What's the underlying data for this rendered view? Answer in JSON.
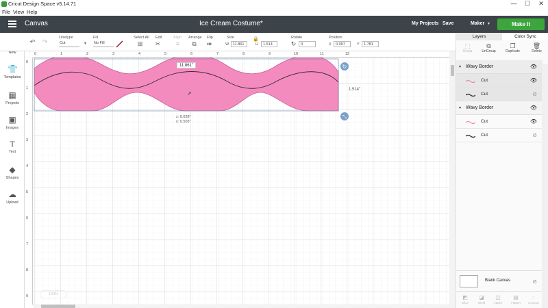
{
  "window": {
    "title": "Cricut Design Space  v5.14.71",
    "minimize": "—",
    "maximize": "☐",
    "close": "✕"
  },
  "menu": {
    "items": [
      "File",
      "View",
      "Help"
    ]
  },
  "header": {
    "section": "Canvas",
    "project_name": "Ice Cream Costume*",
    "my_projects": "My Projects",
    "save": "Save",
    "machine": "Maker",
    "make_it": "Make It",
    "colors": {
      "bar": "#3d4449",
      "make_it": "#3ca53c"
    }
  },
  "toolbar": {
    "linetype_label": "Linetype",
    "linetype_value": "Cut",
    "fill_label": "Fill",
    "fill_value": "No Fill",
    "select_all_label": "Select All",
    "edit_label": "Edit",
    "align_label": "Align",
    "arrange_label": "Arrange",
    "flip_label": "Flip",
    "size_label": "Size",
    "w_label": "W",
    "w_value": "11.861",
    "h_label": "H",
    "h_value": "1.514",
    "rotate_label": "Rotate",
    "rotate_value": "0",
    "position_label": "Position",
    "x_label": "X",
    "x_value": "0.097",
    "y_label": "Y",
    "y_value": "1.781"
  },
  "sidebar": {
    "items": [
      {
        "label": "New",
        "icon": "plus-circle-icon"
      },
      {
        "label": "Templates",
        "icon": "shirt-icon"
      },
      {
        "label": "Projects",
        "icon": "projects-icon"
      },
      {
        "label": "Images",
        "icon": "image-icon"
      },
      {
        "label": "Text",
        "icon": "text-icon"
      },
      {
        "label": "Shapes",
        "icon": "shapes-icon"
      },
      {
        "label": "Upload",
        "icon": "upload-icon"
      }
    ]
  },
  "canvas": {
    "ruler_top": [
      "0",
      "1",
      "2",
      "3",
      "4",
      "5",
      "6",
      "7",
      "8",
      "9",
      "10",
      "11",
      "12"
    ],
    "ruler_left": [
      "0",
      "1",
      "2",
      "3",
      "4",
      "5",
      "6",
      "7",
      "8",
      "9"
    ],
    "width_readout": "11.861\"",
    "height_readout": "1.514\"",
    "cursor_x": "x: 0.028\"",
    "cursor_y": "y: 0.503\"",
    "shape_color": "#f48bbf",
    "zoom": "100%"
  },
  "layers_panel": {
    "tabs": [
      "Layers",
      "Color Sync"
    ],
    "actions": [
      {
        "label": "Group",
        "icon": "group-icon",
        "enabled": false
      },
      {
        "label": "UnGroup",
        "icon": "ungroup-icon",
        "enabled": true
      },
      {
        "label": "Duplicate",
        "icon": "duplicate-icon",
        "enabled": true
      },
      {
        "label": "Delete",
        "icon": "trash-icon",
        "enabled": true
      }
    ],
    "groups": [
      {
        "name": "Wavy Border",
        "layers": [
          {
            "label": "Cut",
            "stroke": "#e07aa8"
          },
          {
            "label": "Cut",
            "stroke": "#222222"
          }
        ]
      },
      {
        "name": "Wavy Border",
        "layers": [
          {
            "label": "Cut",
            "stroke": "#e07aa8"
          },
          {
            "label": "Cut",
            "stroke": "#222222"
          }
        ]
      }
    ],
    "blank_canvas": "Blank Canvas",
    "bottom_actions": [
      "Slice",
      "Weld",
      "Attach",
      "Flatten",
      "Contour"
    ]
  }
}
